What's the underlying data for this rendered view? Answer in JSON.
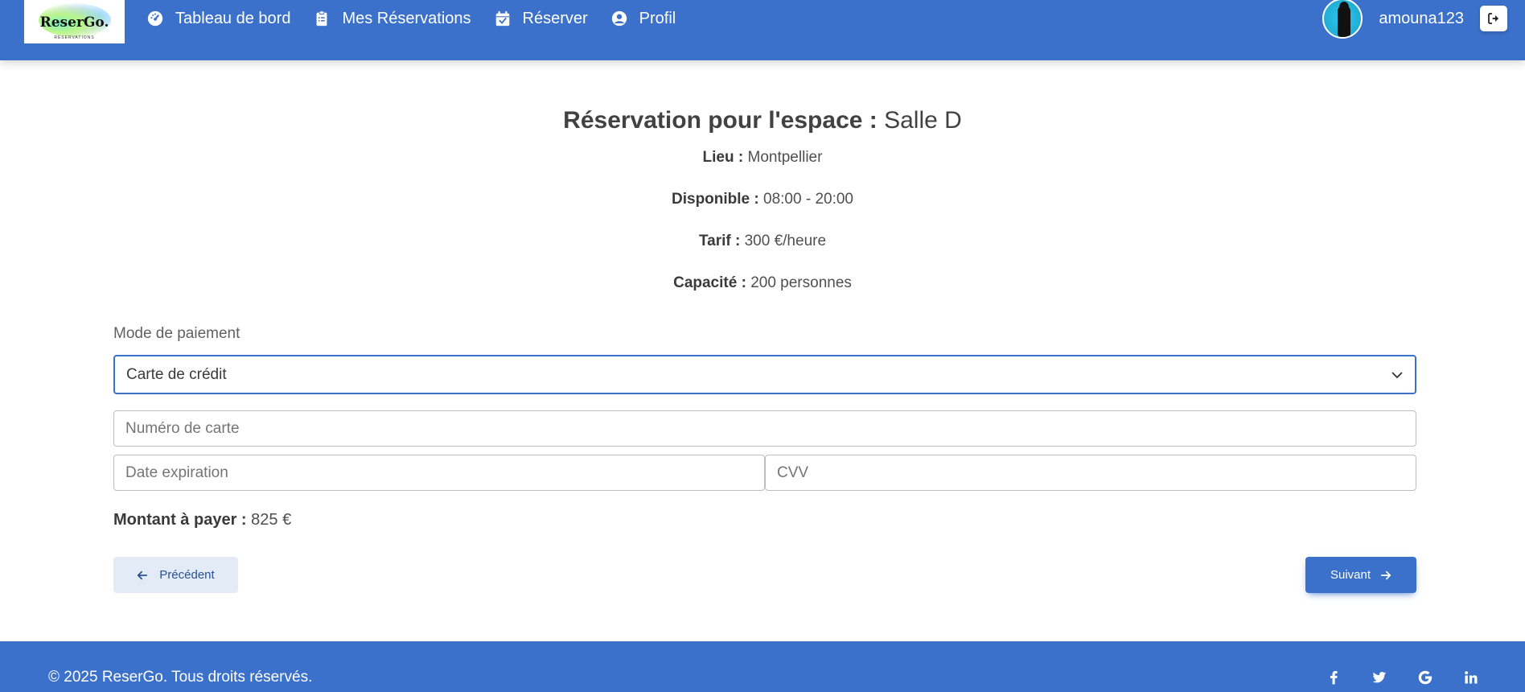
{
  "header": {
    "logo": {
      "text": "ReserGo.",
      "subtitle": "RÉSERVATIONS"
    },
    "nav": [
      {
        "label": "Tableau de bord",
        "icon": "gauge-icon"
      },
      {
        "label": "Mes Réservations",
        "icon": "clipboard-list-icon"
      },
      {
        "label": "Réserver",
        "icon": "calendar-check-icon"
      },
      {
        "label": "Profil",
        "icon": "user-circle-icon"
      }
    ],
    "username": "amouna123",
    "logout_icon": "sign-out-icon"
  },
  "reservation": {
    "title_prefix": "Réservation pour l'espace :",
    "space_name": "Salle D",
    "details": [
      {
        "label": "Lieu :",
        "value": "Montpellier"
      },
      {
        "label": "Disponible :",
        "value": "08:00 - 20:00"
      },
      {
        "label": "Tarif :",
        "value": "300 €/heure"
      },
      {
        "label": "Capacité :",
        "value": "200 personnes"
      }
    ]
  },
  "payment": {
    "label": "Mode de paiement",
    "selected": "Carte de crédit",
    "card_number_placeholder": "Numéro de carte",
    "expiry_placeholder": "Date expiration",
    "cvv_placeholder": "CVV",
    "amount_label": "Montant à payer :",
    "amount_value": "825 €"
  },
  "actions": {
    "prev_label": "Précédent",
    "next_label": "Suivant"
  },
  "footer": {
    "copyright": "© 2025 ReserGo. Tous droits réservés.",
    "social": [
      "facebook-icon",
      "twitter-icon",
      "google-icon",
      "linkedin-icon"
    ]
  },
  "colors": {
    "primary": "#3b71ca",
    "secondary_bg": "#e3ebf7",
    "text": "#4f4f4f"
  }
}
